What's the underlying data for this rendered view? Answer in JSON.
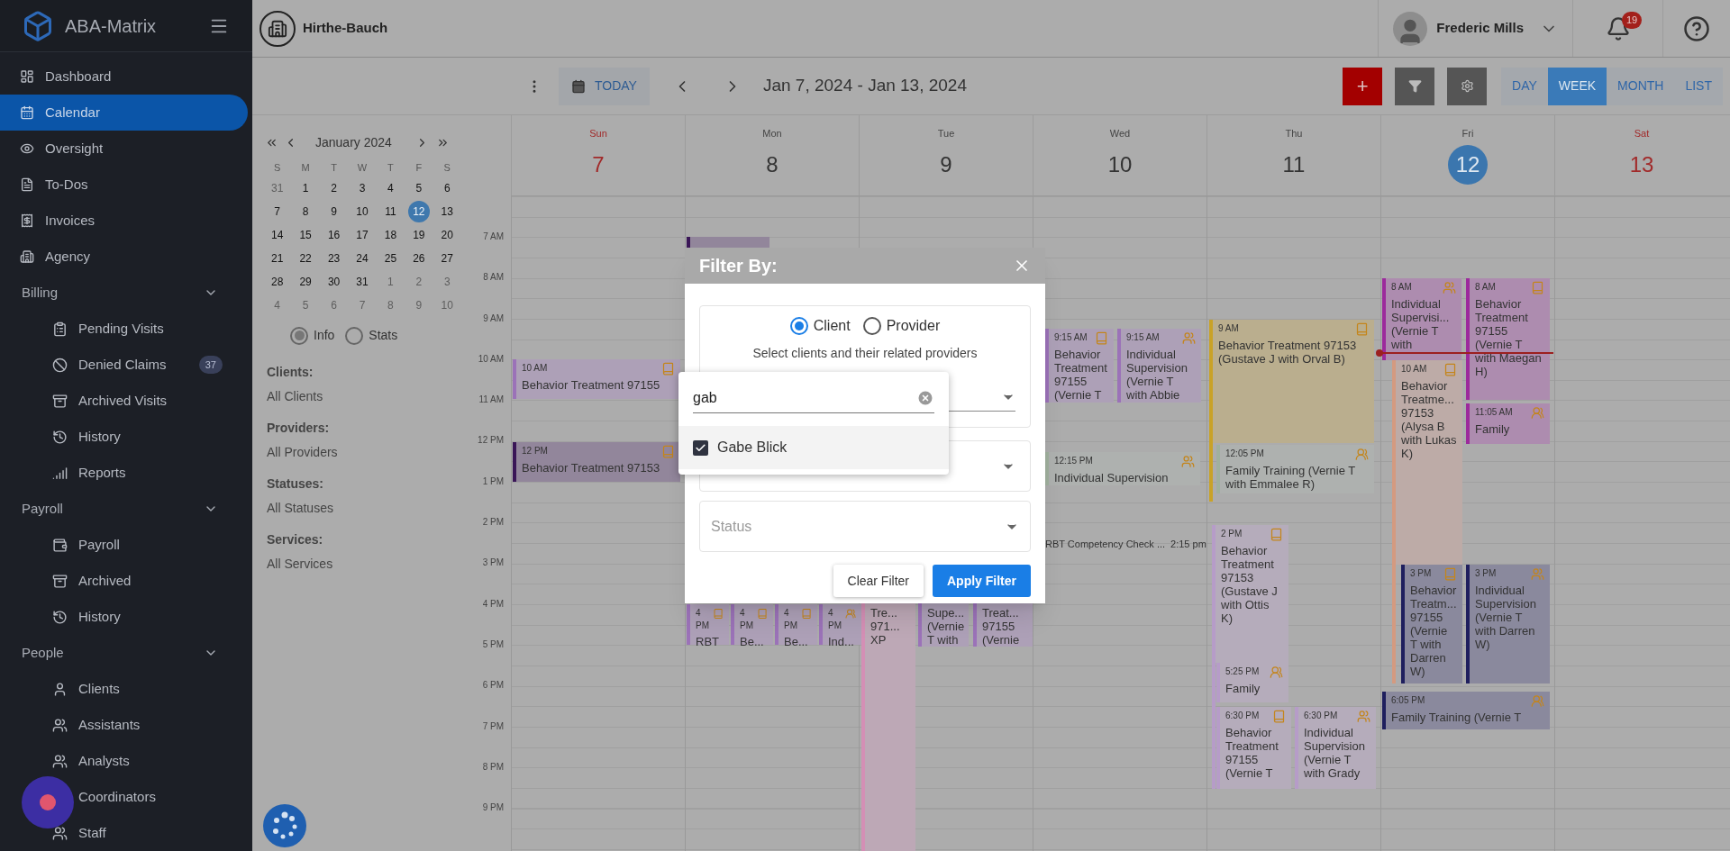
{
  "app": {
    "name": "ABA-Matrix"
  },
  "sidebar": {
    "items": [
      {
        "kind": "link",
        "label": "Dashboard",
        "selected": false
      },
      {
        "kind": "link",
        "label": "Calendar",
        "selected": true
      },
      {
        "kind": "link",
        "label": "Oversight",
        "selected": false
      },
      {
        "kind": "link",
        "label": "To-Dos",
        "selected": false
      },
      {
        "kind": "link",
        "label": "Invoices",
        "selected": false
      },
      {
        "kind": "link",
        "label": "Agency",
        "selected": false
      },
      {
        "kind": "section",
        "label": "Billing",
        "expanded": true,
        "children": [
          {
            "label": "Pending Visits",
            "selected": false
          },
          {
            "label": "Denied Claims",
            "selected": false,
            "badge": "37"
          },
          {
            "label": "Archived Visits",
            "selected": false
          },
          {
            "label": "History",
            "selected": false
          },
          {
            "label": "Reports",
            "selected": false
          }
        ]
      },
      {
        "kind": "section",
        "label": "Payroll",
        "expanded": true,
        "children": [
          {
            "label": "Payroll",
            "selected": false
          },
          {
            "label": "Archived",
            "selected": false
          },
          {
            "label": "History",
            "selected": false
          }
        ]
      },
      {
        "kind": "section",
        "label": "People",
        "expanded": true,
        "children": [
          {
            "label": "Clients",
            "selected": false
          },
          {
            "label": "Assistants",
            "selected": false
          },
          {
            "label": "Analysts",
            "selected": false
          },
          {
            "label": "Coordinators",
            "selected": false
          },
          {
            "label": "Staff",
            "selected": false
          }
        ]
      }
    ]
  },
  "topbar": {
    "organization": "Hirthe-Bauch",
    "user": "Frederic Mills",
    "notifications": "19"
  },
  "toolbar": {
    "today": "TODAY",
    "range": "Jan 7, 2024 - Jan 13, 2024",
    "add": "+",
    "views": [
      {
        "label": "DAY",
        "selected": false
      },
      {
        "label": "WEEK",
        "selected": true
      },
      {
        "label": "MONTH",
        "selected": false
      },
      {
        "label": "LIST",
        "selected": false
      }
    ]
  },
  "mini_calendar": {
    "month": "January 2024",
    "weekdays": [
      "S",
      "M",
      "T",
      "W",
      "T",
      "F",
      "S"
    ],
    "weeks": [
      [
        {
          "d": "31",
          "muted": true,
          "selected": false
        },
        {
          "d": "1",
          "muted": false,
          "selected": false
        },
        {
          "d": "2",
          "muted": false,
          "selected": false
        },
        {
          "d": "3",
          "muted": false,
          "selected": false
        },
        {
          "d": "4",
          "muted": false,
          "selected": false
        },
        {
          "d": "5",
          "muted": false,
          "selected": false
        },
        {
          "d": "6",
          "muted": false,
          "selected": false
        }
      ],
      [
        {
          "d": "7",
          "muted": false,
          "selected": false
        },
        {
          "d": "8",
          "muted": false,
          "selected": false
        },
        {
          "d": "9",
          "muted": false,
          "selected": false
        },
        {
          "d": "10",
          "muted": false,
          "selected": false
        },
        {
          "d": "11",
          "muted": false,
          "selected": false
        },
        {
          "d": "12",
          "muted": false,
          "selected": true
        },
        {
          "d": "13",
          "muted": false,
          "selected": false
        }
      ],
      [
        {
          "d": "14",
          "muted": false,
          "selected": false
        },
        {
          "d": "15",
          "muted": false,
          "selected": false
        },
        {
          "d": "16",
          "muted": false,
          "selected": false
        },
        {
          "d": "17",
          "muted": false,
          "selected": false
        },
        {
          "d": "18",
          "muted": false,
          "selected": false
        },
        {
          "d": "19",
          "muted": false,
          "selected": false
        },
        {
          "d": "20",
          "muted": false,
          "selected": false
        }
      ],
      [
        {
          "d": "21",
          "muted": false,
          "selected": false
        },
        {
          "d": "22",
          "muted": false,
          "selected": false
        },
        {
          "d": "23",
          "muted": false,
          "selected": false
        },
        {
          "d": "24",
          "muted": false,
          "selected": false
        },
        {
          "d": "25",
          "muted": false,
          "selected": false
        },
        {
          "d": "26",
          "muted": false,
          "selected": false
        },
        {
          "d": "27",
          "muted": false,
          "selected": false
        }
      ],
      [
        {
          "d": "28",
          "muted": false,
          "selected": false
        },
        {
          "d": "29",
          "muted": false,
          "selected": false
        },
        {
          "d": "30",
          "muted": false,
          "selected": false
        },
        {
          "d": "31",
          "muted": false,
          "selected": false
        },
        {
          "d": "1",
          "muted": true,
          "selected": false
        },
        {
          "d": "2",
          "muted": true,
          "selected": false
        },
        {
          "d": "3",
          "muted": true,
          "selected": false
        }
      ],
      [
        {
          "d": "4",
          "muted": true,
          "selected": false
        },
        {
          "d": "5",
          "muted": true,
          "selected": false
        },
        {
          "d": "6",
          "muted": true,
          "selected": false
        },
        {
          "d": "7",
          "muted": true,
          "selected": false
        },
        {
          "d": "8",
          "muted": true,
          "selected": false
        },
        {
          "d": "9",
          "muted": true,
          "selected": false
        },
        {
          "d": "10",
          "muted": true,
          "selected": false
        }
      ]
    ],
    "modes": [
      {
        "label": "Info",
        "selected": true
      },
      {
        "label": "Stats",
        "selected": false
      }
    ]
  },
  "summary": [
    {
      "label": "Clients:",
      "value": "All Clients"
    },
    {
      "label": "Providers:",
      "value": "All Providers"
    },
    {
      "label": "Statuses:",
      "value": "All Statuses"
    },
    {
      "label": "Services:",
      "value": "All Services"
    }
  ],
  "days": [
    {
      "name": "Sun",
      "date": "7",
      "weekend": true,
      "today": false
    },
    {
      "name": "Mon",
      "date": "8",
      "weekend": false,
      "today": false
    },
    {
      "name": "Tue",
      "date": "9",
      "weekend": false,
      "today": false
    },
    {
      "name": "Wed",
      "date": "10",
      "weekend": false,
      "today": false
    },
    {
      "name": "Thu",
      "date": "11",
      "weekend": false,
      "today": false
    },
    {
      "name": "Fri",
      "date": "12",
      "weekend": false,
      "today": true
    },
    {
      "name": "Sat",
      "date": "13",
      "weekend": true,
      "today": false
    }
  ],
  "hours": [
    "7 AM",
    "8 AM",
    "9 AM",
    "10 AM",
    "11 AM",
    "12 PM",
    "1 PM",
    "2 PM",
    "3 PM",
    "4 PM",
    "5 PM",
    "6 PM",
    "7 PM",
    "8 PM",
    "9 PM"
  ],
  "events": [
    {
      "kind": "behavior",
      "time": "10 AM",
      "title": "Behavior Treatment 97155",
      "color": "#9b72b8"
    },
    {
      "kind": "behavior",
      "time": "12 PM",
      "title": "Behavior Treatment 97153",
      "color": "#3a1657"
    },
    {
      "kind": "behavior",
      "color": "#3a1657"
    },
    {
      "kind": "behavior",
      "time": "4 PM",
      "title": "RBT",
      "color": "#9b72b8"
    },
    {
      "kind": "behavior",
      "time": "4 PM",
      "title": "Be...",
      "color": "#9b72b8"
    },
    {
      "kind": "behavior",
      "time": "4 PM",
      "title": "Be...",
      "color": "#9b72b8"
    },
    {
      "kind": "family",
      "time": "4 PM",
      "title": "Ind...",
      "color": "#9b72b8"
    },
    {
      "kind": "behavior",
      "title": "Tre... 971... XP",
      "color": "#d48fb5"
    },
    {
      "kind": "supervision",
      "title": "Supe... (Vernie T with",
      "color": "#9b72b8"
    },
    {
      "kind": "behavior",
      "title": "Treat... 97155 (Vernie",
      "color": "#9b72b8"
    },
    {
      "kind": "behavior",
      "time": "9:15 AM",
      "title": "Behavior Treatment 97155 (Vernie T",
      "color": "#9b72b8"
    },
    {
      "kind": "supervision",
      "time": "9:15 AM",
      "title": "Individual Supervision (Vernie T with Abbie",
      "color": "#9b72b8"
    },
    {
      "kind": "supervision",
      "time": "12:15 PM",
      "title": "Individual Supervision",
      "color": "#a0b09e"
    },
    {
      "kind": "task",
      "time": "2:15 pm",
      "title": "RBT Competency Check ..."
    },
    {
      "kind": "behavior",
      "time": "9 AM",
      "title": "Behavior Treatment 97153 (Gustave J with Orval B)",
      "color": "#c9a227"
    },
    {
      "kind": "family",
      "time": "12:05 PM",
      "title": "Family Training (Vernie T with Emmalee R)",
      "color": "#a0b09e"
    },
    {
      "kind": "behavior",
      "time": "2 PM",
      "title": "Behavior Treatment 97153 (Gustave J with Ottis K)",
      "color": "#b69cc8"
    },
    {
      "kind": "family",
      "time": "5:25 PM",
      "title": "Family",
      "color": "#b69cc8"
    },
    {
      "kind": "behavior",
      "time": "6:30 PM",
      "title": "Behavior Treatment 97155 (Vernie T",
      "color": "#b69cc8"
    },
    {
      "kind": "supervision",
      "time": "6:30 PM",
      "title": "Individual Supervision (Vernie T with Grady",
      "color": "#b69cc8"
    },
    {
      "kind": "supervision",
      "time": "8 AM",
      "title": "Individual Supervisi... (Vernie T with",
      "color": "#9c2a9c"
    },
    {
      "kind": "behavior",
      "time": "8 AM",
      "title": "Behavior Treatment 97155 (Vernie T with Maegan H)",
      "color": "#9c2a9c"
    },
    {
      "kind": "behavior",
      "time": "10 AM",
      "title": "Behavior Treatme... 97153 (Alysa B with Lukas K)",
      "color": "#d49a80"
    },
    {
      "kind": "family",
      "time": "11:05 AM",
      "title": "Family",
      "color": "#9c2a9c"
    },
    {
      "kind": "behavior",
      "time": "3 PM",
      "title": "Behavior Treatm... 97155 (Vernie T with Darren W)",
      "color": "#1f1f5e"
    },
    {
      "kind": "supervision",
      "time": "3 PM",
      "title": "Individual Supervision (Vernie T with Darren W)",
      "color": "#1f1f5e"
    },
    {
      "kind": "family",
      "time": "6:05 PM",
      "title": "Family Training (Vernie T",
      "color": "#1f1f5e"
    }
  ],
  "dialog": {
    "title": "Filter By:",
    "modes": [
      {
        "label": "Client",
        "selected": true
      },
      {
        "label": "Provider",
        "selected": false
      }
    ],
    "hint": "Select clients and their related providers",
    "status_placeholder": "Status",
    "buttons": [
      {
        "label": "Clear Filter",
        "kind": "secondary"
      },
      {
        "label": "Apply Filter",
        "kind": "primary"
      }
    ],
    "popup": {
      "search": "gab",
      "options": [
        {
          "label": "Gabe Blick",
          "checked": true
        }
      ]
    }
  }
}
